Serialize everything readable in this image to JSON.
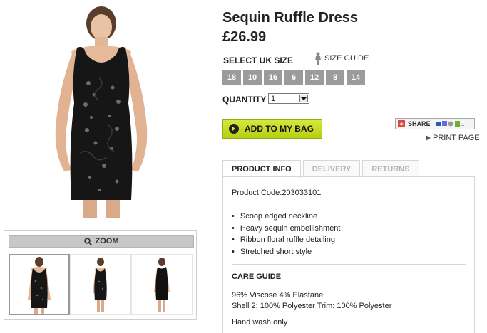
{
  "product": {
    "title": "Sequin Ruffle Dress",
    "price": "£26.99"
  },
  "sizes": {
    "label": "SELECT UK SIZE",
    "guide_label": "SIZE GUIDE",
    "options": [
      "18",
      "10",
      "16",
      "6",
      "12",
      "8",
      "14"
    ]
  },
  "quantity": {
    "label": "QUANTITY",
    "value": "1"
  },
  "actions": {
    "add_to_bag": "ADD TO MY BAG",
    "share": "SHARE",
    "print": "PRINT PAGE"
  },
  "gallery": {
    "zoom_label": "ZOOM"
  },
  "tabs": [
    {
      "label": "PRODUCT INFO",
      "active": true
    },
    {
      "label": "DELIVERY",
      "active": false
    },
    {
      "label": "RETURNS",
      "active": false
    }
  ],
  "info": {
    "product_code": "Product Code:203033101",
    "features": [
      "Scoop edged neckline",
      "Heavy sequin embellishment",
      "Ribbon floral ruffle detailing",
      "Stretched short style"
    ],
    "care_title": "CARE GUIDE",
    "care_lines": [
      "96% Viscose 4% Elastane",
      "Shell 2: 100% Polyester Trim: 100% Polyester",
      "Hand wash only"
    ]
  },
  "colors": {
    "accent_button": "#c9de22",
    "size_button": "#9b9b9b",
    "dress": "#161616"
  }
}
